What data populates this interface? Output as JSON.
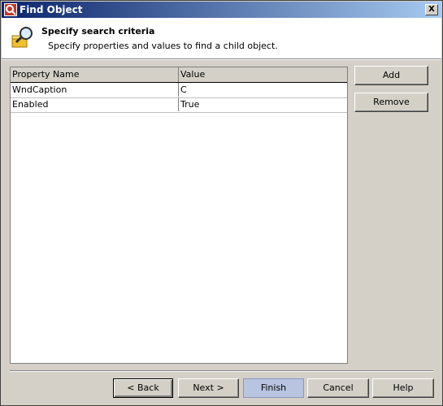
{
  "window": {
    "title": "Find Object",
    "close_label": "X"
  },
  "header": {
    "title": "Specify search criteria",
    "subtitle": "Specify properties and values to find a child object."
  },
  "grid": {
    "columns": [
      "Property Name",
      "Value"
    ],
    "rows": [
      {
        "property": "WndCaption",
        "value": "C"
      },
      {
        "property": "Enabled",
        "value": "True"
      }
    ]
  },
  "side_buttons": {
    "add": "Add",
    "remove": "Remove"
  },
  "footer": {
    "back": "< Back",
    "next": "Next >",
    "finish": "Finish",
    "cancel": "Cancel",
    "help": "Help"
  },
  "colors": {
    "titlebar_start": "#0a246a",
    "titlebar_end": "#a6caf0",
    "dialog_bg": "#d4d0c8"
  },
  "icons": {
    "title": "app-icon",
    "header": "search-object-icon"
  }
}
